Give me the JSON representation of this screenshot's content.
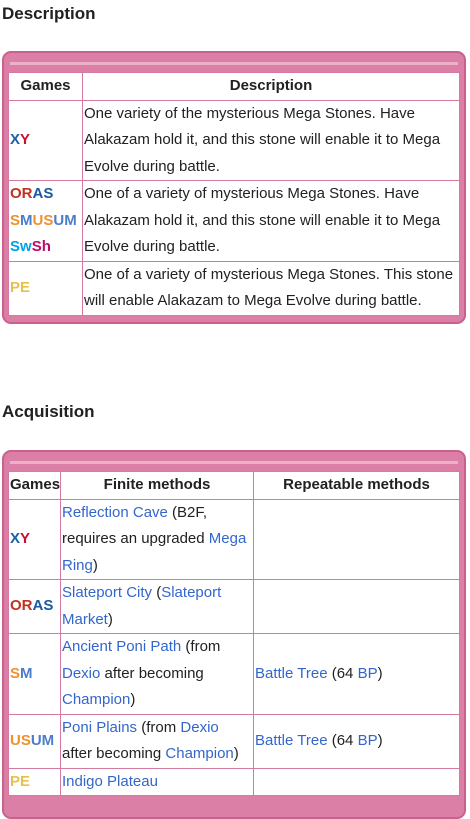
{
  "description_heading": "Description",
  "acquisition_heading": "Acquisition",
  "desc_table": {
    "col_games": "Games",
    "col_description": "Description",
    "rows": [
      {
        "text": "One variety of the mysterious Mega Stones. Have Alakazam hold it, and this stone will enable it to Mega Evolve during battle."
      },
      {
        "text": "One of a variety of mysterious Mega Stones. Have Alakazam hold it, and this stone will enable it to Mega Evolve during battle."
      },
      {
        "text": "One of a variety of mysterious Mega Stones. This stone will enable Alakazam to Mega Evolve during battle."
      }
    ]
  },
  "acq_table": {
    "col_games": "Games",
    "col_finite": "Finite methods",
    "col_repeatable": "Repeatable methods",
    "rows": [
      {
        "finite": {
          "link1": "Reflection Cave",
          "text1": " (B2F, requires an upgraded ",
          "link2": "Mega Ring",
          "text2": ")"
        }
      },
      {
        "finite": {
          "link1": "Slateport City",
          "text1": " (",
          "link2": "Slateport Market",
          "text2": ")"
        }
      },
      {
        "finite": {
          "link1": "Ancient Poni Path",
          "text1": " (from ",
          "link2": "Dexio",
          "text2": " after becoming ",
          "link3": "Champion",
          "text3": ")"
        },
        "repeat": {
          "link1": "Battle Tree",
          "text1": " (64 ",
          "link2": "BP",
          "text2": ")"
        }
      },
      {
        "finite": {
          "link1": "Poni Plains",
          "text1": " (from ",
          "link2": "Dexio",
          "text2": " after becoming ",
          "link3": "Champion",
          "text3": ")"
        },
        "repeat": {
          "link1": "Battle Tree",
          "text1": " (64 ",
          "link2": "BP",
          "text2": ")"
        }
      },
      {
        "finite": {
          "link1": "Indigo Plateau"
        }
      }
    ]
  },
  "games": {
    "xy": [
      "X",
      "Y"
    ],
    "oras": [
      "OR",
      "AS"
    ],
    "sm": [
      "S",
      "M"
    ],
    "usum": [
      "US",
      "UM"
    ],
    "swsh": [
      "Sw",
      "Sh"
    ],
    "pe": "PE"
  },
  "colors": {
    "box": "#dc7fa6",
    "border": "#d47aa0",
    "link": "#3366cc"
  }
}
